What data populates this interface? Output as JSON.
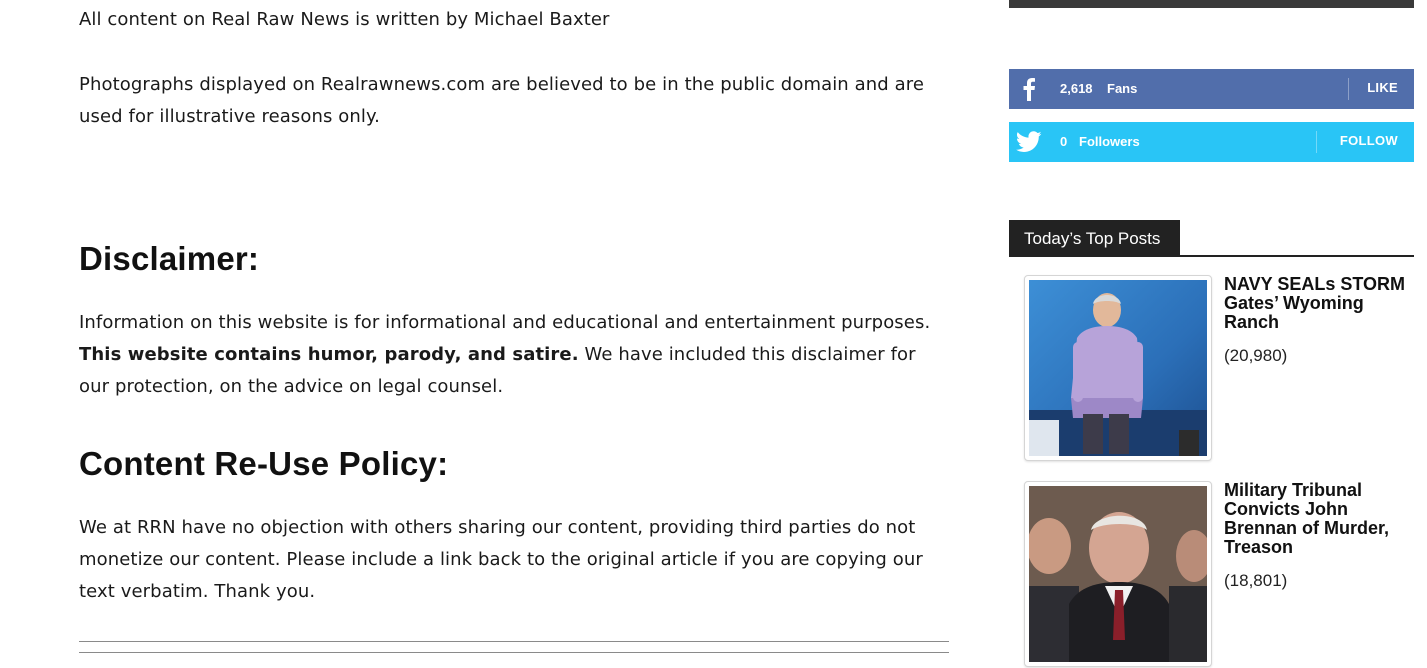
{
  "article": {
    "byline": "All content on Real Raw News is written by Michael Baxter",
    "photo_note": "Photographs displayed on Realrawnews.com are believed to be in the public domain and are used for illustrative reasons only.",
    "disclaimer_heading": "Disclaimer:",
    "disclaimer_text_a": "Information on this website is for informational and educational and entertainment purposes.",
    "disclaimer_text_bold": "This website contains humor, parody, and satire.",
    "disclaimer_text_b": "We have included this disclaimer for our protection, on the advice on legal counsel.",
    "reuse_heading": "Content Re-Use Policy:",
    "reuse_text": "We at RRN have no objection with others sharing our content, providing third parties do not monetize our content. Please include a link back to the original article if you are copying our text verbatim. Thank you."
  },
  "sidebar": {
    "facebook": {
      "count": "2,618",
      "unit": "Fans",
      "action": "LIKE",
      "color": "#516eab",
      "icon": "facebook-icon"
    },
    "twitter": {
      "count": "0",
      "unit": "Followers",
      "action": "FOLLOW",
      "color": "#29c5f6",
      "icon": "twitter-icon"
    },
    "top_posts": {
      "heading": "Today’s Top Posts",
      "items": [
        {
          "title": "NAVY SEALs STORM Gates’ Wyoming Ranch",
          "views": "(20,980)"
        },
        {
          "title": "Military Tribunal Convicts John Brennan of Murder, Treason",
          "views": "(18,801)"
        }
      ]
    }
  }
}
